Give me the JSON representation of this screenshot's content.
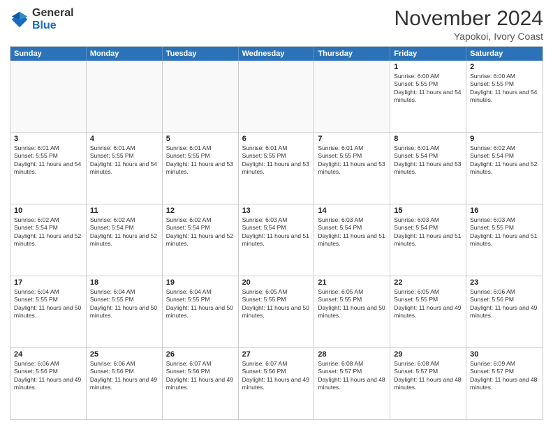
{
  "header": {
    "logo_general": "General",
    "logo_blue": "Blue",
    "month": "November 2024",
    "location": "Yapokoi, Ivory Coast"
  },
  "weekdays": [
    "Sunday",
    "Monday",
    "Tuesday",
    "Wednesday",
    "Thursday",
    "Friday",
    "Saturday"
  ],
  "weeks": [
    [
      {
        "day": "",
        "empty": true
      },
      {
        "day": "",
        "empty": true
      },
      {
        "day": "",
        "empty": true
      },
      {
        "day": "",
        "empty": true
      },
      {
        "day": "",
        "empty": true
      },
      {
        "day": "1",
        "sunrise": "6:00 AM",
        "sunset": "5:55 PM",
        "daylight": "11 hours and 54 minutes."
      },
      {
        "day": "2",
        "sunrise": "6:00 AM",
        "sunset": "5:55 PM",
        "daylight": "11 hours and 54 minutes."
      }
    ],
    [
      {
        "day": "3",
        "sunrise": "6:01 AM",
        "sunset": "5:55 PM",
        "daylight": "11 hours and 54 minutes."
      },
      {
        "day": "4",
        "sunrise": "6:01 AM",
        "sunset": "5:55 PM",
        "daylight": "11 hours and 54 minutes."
      },
      {
        "day": "5",
        "sunrise": "6:01 AM",
        "sunset": "5:55 PM",
        "daylight": "11 hours and 53 minutes."
      },
      {
        "day": "6",
        "sunrise": "6:01 AM",
        "sunset": "5:55 PM",
        "daylight": "11 hours and 53 minutes."
      },
      {
        "day": "7",
        "sunrise": "6:01 AM",
        "sunset": "5:55 PM",
        "daylight": "11 hours and 53 minutes."
      },
      {
        "day": "8",
        "sunrise": "6:01 AM",
        "sunset": "5:54 PM",
        "daylight": "11 hours and 53 minutes."
      },
      {
        "day": "9",
        "sunrise": "6:02 AM",
        "sunset": "5:54 PM",
        "daylight": "11 hours and 52 minutes."
      }
    ],
    [
      {
        "day": "10",
        "sunrise": "6:02 AM",
        "sunset": "5:54 PM",
        "daylight": "11 hours and 52 minutes."
      },
      {
        "day": "11",
        "sunrise": "6:02 AM",
        "sunset": "5:54 PM",
        "daylight": "11 hours and 52 minutes."
      },
      {
        "day": "12",
        "sunrise": "6:02 AM",
        "sunset": "5:54 PM",
        "daylight": "11 hours and 52 minutes."
      },
      {
        "day": "13",
        "sunrise": "6:03 AM",
        "sunset": "5:54 PM",
        "daylight": "11 hours and 51 minutes."
      },
      {
        "day": "14",
        "sunrise": "6:03 AM",
        "sunset": "5:54 PM",
        "daylight": "11 hours and 51 minutes."
      },
      {
        "day": "15",
        "sunrise": "6:03 AM",
        "sunset": "5:54 PM",
        "daylight": "11 hours and 51 minutes."
      },
      {
        "day": "16",
        "sunrise": "6:03 AM",
        "sunset": "5:55 PM",
        "daylight": "11 hours and 51 minutes."
      }
    ],
    [
      {
        "day": "17",
        "sunrise": "6:04 AM",
        "sunset": "5:55 PM",
        "daylight": "11 hours and 50 minutes."
      },
      {
        "day": "18",
        "sunrise": "6:04 AM",
        "sunset": "5:55 PM",
        "daylight": "11 hours and 50 minutes."
      },
      {
        "day": "19",
        "sunrise": "6:04 AM",
        "sunset": "5:55 PM",
        "daylight": "11 hours and 50 minutes."
      },
      {
        "day": "20",
        "sunrise": "6:05 AM",
        "sunset": "5:55 PM",
        "daylight": "11 hours and 50 minutes."
      },
      {
        "day": "21",
        "sunrise": "6:05 AM",
        "sunset": "5:55 PM",
        "daylight": "11 hours and 50 minutes."
      },
      {
        "day": "22",
        "sunrise": "6:05 AM",
        "sunset": "5:55 PM",
        "daylight": "11 hours and 49 minutes."
      },
      {
        "day": "23",
        "sunrise": "6:06 AM",
        "sunset": "5:56 PM",
        "daylight": "11 hours and 49 minutes."
      }
    ],
    [
      {
        "day": "24",
        "sunrise": "6:06 AM",
        "sunset": "5:56 PM",
        "daylight": "11 hours and 49 minutes."
      },
      {
        "day": "25",
        "sunrise": "6:06 AM",
        "sunset": "5:56 PM",
        "daylight": "11 hours and 49 minutes."
      },
      {
        "day": "26",
        "sunrise": "6:07 AM",
        "sunset": "5:56 PM",
        "daylight": "11 hours and 49 minutes."
      },
      {
        "day": "27",
        "sunrise": "6:07 AM",
        "sunset": "5:56 PM",
        "daylight": "11 hours and 49 minutes."
      },
      {
        "day": "28",
        "sunrise": "6:08 AM",
        "sunset": "5:57 PM",
        "daylight": "11 hours and 48 minutes."
      },
      {
        "day": "29",
        "sunrise": "6:08 AM",
        "sunset": "5:57 PM",
        "daylight": "11 hours and 48 minutes."
      },
      {
        "day": "30",
        "sunrise": "6:09 AM",
        "sunset": "5:57 PM",
        "daylight": "11 hours and 48 minutes."
      }
    ]
  ]
}
